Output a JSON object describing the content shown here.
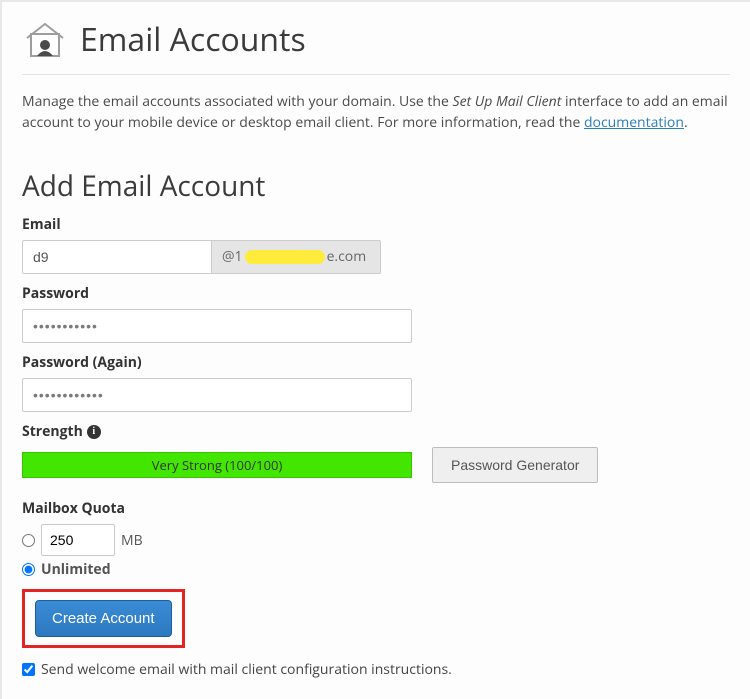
{
  "header": {
    "title": "Email Accounts"
  },
  "intro": {
    "part1": "Manage the email accounts associated with your domain. Use the ",
    "italic": "Set Up Mail Client",
    "part2": " interface to add an email account to your mobile device or desktop email client. For more information, read the ",
    "link": "documentation",
    "part3": "."
  },
  "section_title": "Add Email Account",
  "email": {
    "label": "Email",
    "value": "d9",
    "at": "@1",
    "domain_suffix": "e.com"
  },
  "password": {
    "label": "Password",
    "value": "•••••••••••"
  },
  "password_again": {
    "label": "Password (Again)",
    "value": "••••••••••••"
  },
  "strength": {
    "label": "Strength",
    "value": "Very Strong (100/100)",
    "generator_label": "Password Generator"
  },
  "quota": {
    "label": "Mailbox Quota",
    "value": "250",
    "unit": "MB",
    "unlimited_label": "Unlimited"
  },
  "create_label": "Create Account",
  "welcome_label": "Send welcome email with mail client configuration instructions."
}
